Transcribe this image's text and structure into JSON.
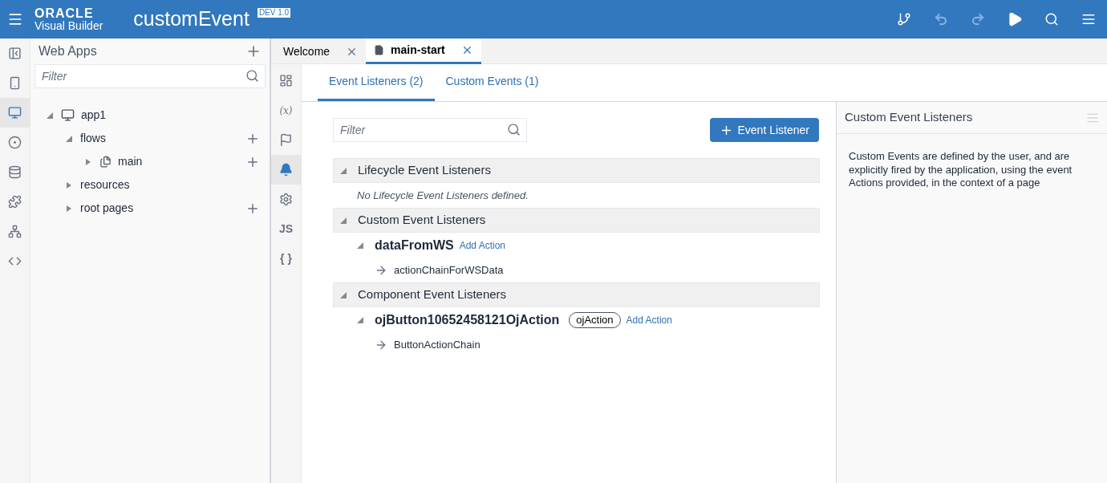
{
  "header": {
    "logo_top": "ORACLE",
    "logo_bottom": "Visual Builder",
    "title": "customEvent",
    "badge": "DEV 1.0",
    "toolbar": [
      {
        "kind": "git",
        "disabled": false
      },
      {
        "kind": "undo",
        "disabled": true
      },
      {
        "kind": "redo",
        "disabled": true
      },
      {
        "kind": "run",
        "disabled": false
      },
      {
        "kind": "search",
        "disabled": false
      },
      {
        "kind": "menu",
        "disabled": false
      }
    ]
  },
  "left_rail": [
    {
      "kind": "panel",
      "selected": false
    },
    {
      "kind": "mobile",
      "selected": false
    },
    {
      "kind": "web",
      "selected": true
    },
    {
      "kind": "service",
      "selected": false
    },
    {
      "kind": "data",
      "selected": false
    },
    {
      "kind": "components",
      "selected": false
    },
    {
      "kind": "processes",
      "selected": false
    },
    {
      "kind": "source",
      "selected": false
    }
  ],
  "navigator": {
    "title": "Web Apps",
    "filter": {
      "placeholder": "Filter"
    },
    "tree": [
      {
        "label": "app1",
        "kind": "app",
        "expanded": true,
        "can_add": false,
        "children": [
          {
            "label": "flows",
            "expanded": true,
            "can_add": true,
            "children": [
              {
                "label": "main",
                "kind": "flow",
                "expanded": false,
                "can_add": true
              }
            ]
          },
          {
            "label": "resources",
            "expanded": false,
            "can_add": false
          },
          {
            "label": "root pages",
            "expanded": false,
            "can_add": true
          }
        ]
      }
    ]
  },
  "editor_tabs": [
    {
      "label": "Welcome",
      "kind": "welcome",
      "selected": false
    },
    {
      "label": "main-start",
      "kind": "page",
      "selected": true
    }
  ],
  "side_rail": [
    {
      "kind": "designer",
      "selected": false
    },
    {
      "kind": "variables",
      "label": "(x)",
      "selected": false
    },
    {
      "kind": "actions",
      "selected": false
    },
    {
      "kind": "events",
      "selected": true
    },
    {
      "kind": "settings",
      "selected": false
    },
    {
      "kind": "js",
      "label": "JS",
      "selected": false
    },
    {
      "kind": "json",
      "label": "{ }",
      "selected": false
    }
  ],
  "sub_tabs": [
    {
      "label": "Event Listeners (2)",
      "selected": true
    },
    {
      "label": "Custom Events (1)",
      "selected": false
    }
  ],
  "filter": {
    "placeholder": "Filter"
  },
  "add_button": "Event Listener",
  "sections": [
    {
      "title": "Lifecycle Event Listeners",
      "expanded": true,
      "empty_message": "No Lifecycle Event Listeners defined."
    },
    {
      "title": "Custom Event Listeners",
      "expanded": true,
      "listeners": [
        {
          "name": "dataFromWS",
          "expanded": true,
          "add_action": "Add Action",
          "chains": [
            "actionChainForWSData"
          ]
        }
      ]
    },
    {
      "title": "Component Event Listeners",
      "expanded": true,
      "listeners": [
        {
          "name": "ojButton10652458121OjAction",
          "expanded": true,
          "tag": "ojAction",
          "add_action": "Add Action",
          "chains": [
            "ButtonActionChain"
          ]
        }
      ]
    }
  ],
  "properties": {
    "title": "Custom Event Listeners",
    "description": "Custom Events are defined by the user, and are explicitly fired by the application, using the event Actions provided, in the context of a page"
  }
}
